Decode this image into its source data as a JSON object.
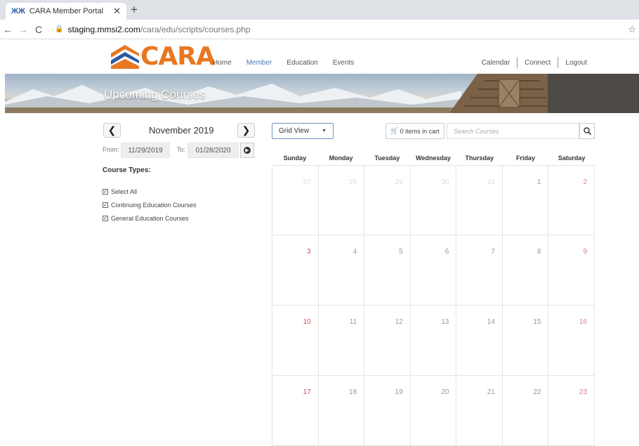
{
  "browser": {
    "tab_title": "CARA Member Portal",
    "favicon": "CARA-favicon",
    "url_host": "staging.mmsi2.com",
    "url_path": "/cara/edu/scripts/courses.php"
  },
  "site": {
    "logo_text": "CARA",
    "main_nav": [
      "Home",
      "Member",
      "Education",
      "Events"
    ],
    "active_nav": "Member",
    "util_nav": [
      "Calendar",
      "Connect",
      "Logout"
    ],
    "banner_title": "Upcoming Courses",
    "brand_colors": {
      "orange": "#e87722",
      "blue": "#4b7bb5"
    }
  },
  "filters": {
    "month_label": "November 2019",
    "from_label": "From:",
    "from_value": "11/29/2019",
    "to_label": "To:",
    "to_value": "01/28/2020",
    "course_types_label": "Course Types:",
    "checkboxes": [
      {
        "label": "Select All",
        "checked": true
      },
      {
        "label": "Continuing Education Courses",
        "checked": true
      },
      {
        "label": "General Education Courses",
        "checked": true
      }
    ]
  },
  "toolbar": {
    "view_select": "Grid View",
    "cart_label": "0 items in cart",
    "search_placeholder": "Search Courses"
  },
  "calendar": {
    "weekdays": [
      "Sunday",
      "Monday",
      "Tuesday",
      "Wednesday",
      "Thursday",
      "Friday",
      "Saturday"
    ],
    "weeks": [
      [
        {
          "d": "27",
          "o": true
        },
        {
          "d": "28",
          "o": true
        },
        {
          "d": "29",
          "o": true
        },
        {
          "d": "30",
          "o": true
        },
        {
          "d": "31",
          "o": true
        },
        {
          "d": "1"
        },
        {
          "d": "2"
        }
      ],
      [
        {
          "d": "3"
        },
        {
          "d": "4"
        },
        {
          "d": "5"
        },
        {
          "d": "6"
        },
        {
          "d": "7"
        },
        {
          "d": "8"
        },
        {
          "d": "9"
        }
      ],
      [
        {
          "d": "10"
        },
        {
          "d": "11"
        },
        {
          "d": "12"
        },
        {
          "d": "13"
        },
        {
          "d": "14"
        },
        {
          "d": "15"
        },
        {
          "d": "16"
        }
      ],
      [
        {
          "d": "17"
        },
        {
          "d": "18"
        },
        {
          "d": "19"
        },
        {
          "d": "20"
        },
        {
          "d": "21"
        },
        {
          "d": "22"
        },
        {
          "d": "23"
        }
      ]
    ]
  }
}
